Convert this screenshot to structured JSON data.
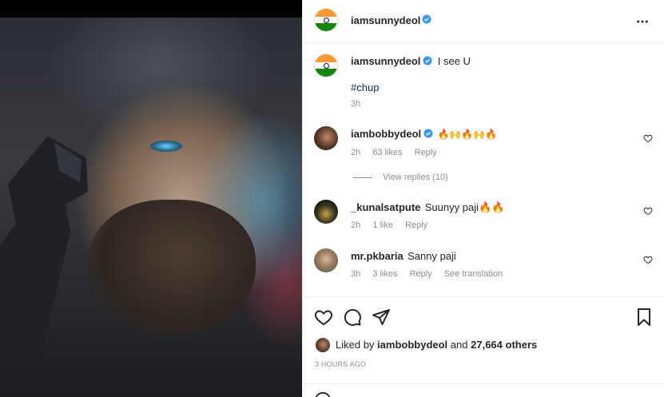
{
  "post": {
    "author": "iamsunnydeol",
    "caption": "I see U",
    "hashtag": "#chup",
    "time_ago": "3h"
  },
  "header": {
    "username": "iamsunnydeol",
    "more_icon": "more-horizontal-icon"
  },
  "comments": [
    {
      "username": "iambobbydeol",
      "text": "🔥🙌🔥🙌🔥",
      "time": "2h",
      "likes": "63 likes",
      "reply_label": "Reply",
      "view_replies": "View replies (10)",
      "verified": true
    },
    {
      "username": "_kunalsatpute",
      "text": "Suunyy paji🔥🔥",
      "time": "2h",
      "likes": "1 like",
      "reply_label": "Reply"
    },
    {
      "username": "mr.pkbaria",
      "text": "Sanny paji",
      "time": "3h",
      "likes": "3 likes",
      "reply_label": "Reply",
      "see_translation": "See translation"
    }
  ],
  "actions": {
    "like_icon": "heart-icon",
    "comment_icon": "comment-icon",
    "share_icon": "share-icon",
    "save_icon": "bookmark-icon"
  },
  "likes": {
    "prefix": "Liked by",
    "user": "iambobbydeol",
    "and": "and",
    "others": "27,664 others"
  },
  "posted": "3 HOURS AGO",
  "colors": {
    "verified": "#3897f0",
    "link": "#00376b",
    "muted": "#8e8e8e",
    "divider": "#efefef"
  }
}
